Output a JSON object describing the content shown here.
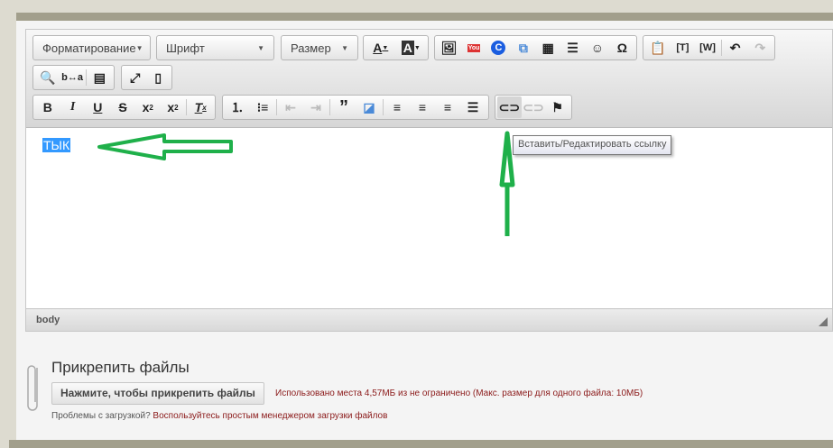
{
  "toolbar": {
    "format_label": "Форматирование",
    "font_label": "Шрифт",
    "size_label": "Размер",
    "row1_buttons": [
      "text-color",
      "bg-color",
      "image",
      "youtube",
      "c-plugin",
      "templates-copy",
      "table",
      "horizontal-rule",
      "smiley",
      "special-char",
      "paste",
      "paste-text",
      "paste-word",
      "undo",
      "redo"
    ],
    "row2_buttons": [
      "find",
      "replace",
      "select-all",
      "maximize",
      "show-blocks"
    ],
    "row3_buttons": [
      "bold",
      "italic",
      "underline",
      "strike",
      "subscript",
      "superscript",
      "remove-format",
      "numbered-list",
      "bulleted-list",
      "outdent",
      "indent",
      "blockquote",
      "templates",
      "align-left",
      "align-center",
      "align-right",
      "justify",
      "link",
      "unlink",
      "anchor"
    ]
  },
  "editor": {
    "selected_text": "ТЫК",
    "status_path": "body"
  },
  "tooltip": "Вставить/Редактировать ссылку",
  "attachments": {
    "title": "Прикрепить файлы",
    "button": "Нажмите, чтобы прикрепить файлы",
    "usage": "Использовано места 4,57МБ из не ограничено (Макс. размер для одного файла: 10МБ)",
    "help_prefix": "Проблемы с загрузкой?",
    "help_link": "Воспользуйтесь простым менеджером загрузки файлов"
  },
  "colors": {
    "selection": "#3399ff",
    "arrow": "#1fb04a",
    "link": "#8b1a1a"
  }
}
